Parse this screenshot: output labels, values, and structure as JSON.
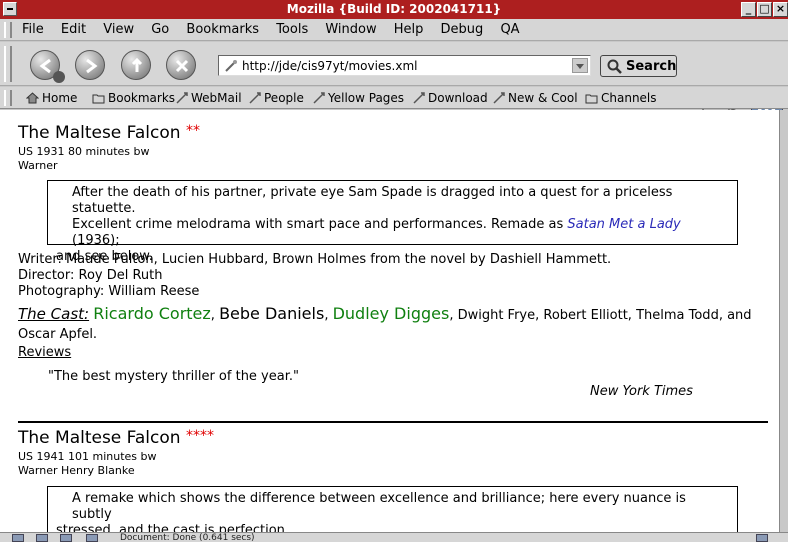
{
  "window": {
    "title": "Mozilla {Build ID: 2002041711}"
  },
  "menubar": {
    "items": [
      "File",
      "Edit",
      "View",
      "Go",
      "Bookmarks",
      "Tools",
      "Window",
      "Help",
      "Debug",
      "QA"
    ]
  },
  "navbar": {
    "url": "http://jde/cis97yt/movies.xml",
    "search_label": "Search",
    "buttons": [
      "back-icon",
      "forward-icon",
      "reload-icon",
      "stop-icon"
    ]
  },
  "personal_toolbar": {
    "items": [
      {
        "label": "Home",
        "icon": "home-icon"
      },
      {
        "label": "Bookmarks",
        "icon": "folder-icon"
      },
      {
        "label": "WebMail",
        "icon": "bookmark-icon"
      },
      {
        "label": "People",
        "icon": "bookmark-icon"
      },
      {
        "label": "Yellow Pages",
        "icon": "bookmark-icon"
      },
      {
        "label": "Download",
        "icon": "bookmark-icon"
      },
      {
        "label": "New & Cool",
        "icon": "bookmark-icon"
      },
      {
        "label": "Channels",
        "icon": "folder-icon"
      }
    ]
  },
  "movies": [
    {
      "title": "The Maltese Falcon",
      "stars": "**",
      "meta_line1": "US 1931 80 minutes bw",
      "meta_line2": "Warner",
      "synopsis_a": "After the death of his partner, private eye Sam Spade is dragged into a quest for a priceless statuette.",
      "synopsis_b": "Excellent crime melodrama with smart pace and performances. Remade as",
      "synopsis_link": "Satan Met a Lady",
      "synopsis_c": "(1936);",
      "synopsis_d": "and see below.",
      "writer": "Writer: Maude Fulton, Lucien Hubbard, Brown Holmes from the novel by Dashiell Hammett.",
      "director": "Director: Roy Del Ruth",
      "photography": "Photography: William Reese",
      "cast_label": "The Cast:",
      "cast_star1": "Ricardo Cortez",
      "cast_sep1": ",",
      "cast_star2": "Bebe Daniels",
      "cast_sep2": ",",
      "cast_star3": "Dudley Digges",
      "cast_rest": ", Dwight Frye, Robert Elliott, Thelma Todd, and Oscar Apfel.",
      "reviews_label": "Reviews",
      "quote": "\"The best mystery thriller of the year.\"",
      "quote_source": "New York Times"
    },
    {
      "title": "The Maltese Falcon",
      "stars": "****",
      "meta_line1": "US 1941 101 minutes bw",
      "meta_line2": "Warner Henry Blanke",
      "synopsis_a": "A remake which shows the difference between excellence and brilliance; here every nuance is subtly",
      "synopsis_b": "stressed, and the cast is perfection."
    }
  ],
  "status": {
    "text": "Document: Done (0.641 secs)"
  }
}
